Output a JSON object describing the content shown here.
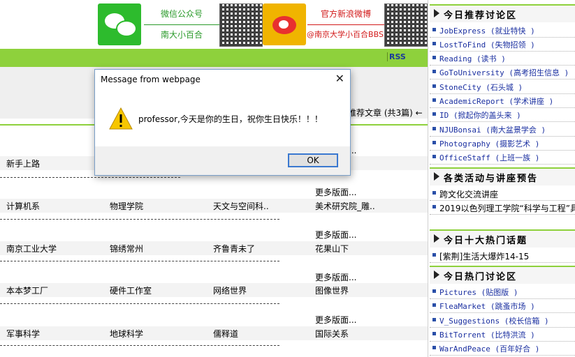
{
  "banner": {
    "wechat_label": "微信公众号",
    "wechat_name": "南大小百合",
    "weibo_label": "官方新浪微博",
    "weibo_handle": "@南京大学小百合BBS"
  },
  "topbar": {
    "rss_label": "RSS"
  },
  "recommend_label": "多推荐文章 (共3篇) ←",
  "boards": {
    "more_label": "更多版面...",
    "rows": [
      [
        "新手上路"
      ],
      [
        "计算机系",
        "物理学院",
        "天文与空间科..",
        "美术研究院_雕.."
      ],
      [
        "南京工业大学",
        "锦绣常州",
        "齐鲁青未了",
        "花果山下"
      ],
      [
        "本本梦工厂",
        "硬件工作室",
        "网络世界",
        "图像世界"
      ],
      [
        "军事科学",
        "地球科学",
        "儒释道",
        "国际关系"
      ]
    ]
  },
  "sidebar": {
    "sections": [
      {
        "title": "今日推荐讨论区",
        "items": [
          "JobExpress (就业特快 )",
          "LostToFind (失物招领 )",
          "Reading (读书 )",
          "GoToUniversity (高考招生信息 )",
          "StoneCity (石头城 )",
          "AcademicReport (学术讲座 )",
          "ID (掀起你的盖头来 )",
          "NJUBonsai (南大盆景学会 )",
          "Photography (摄影艺术 )",
          "OfficeStaff (上班一族 )"
        ]
      },
      {
        "title": "各类活动与讲座预告",
        "items": [
          "跨文化交流讲座",
          "2019以色列理工学院“科学与工程”具"
        ]
      },
      {
        "title": "今日十大热门话题",
        "items": [
          "[紫荆]生活大爆炸14-15"
        ]
      },
      {
        "title": "今日热门讨论区",
        "items": [
          "Pictures (贴图版 )",
          "FleaMarket (跳蚤市场 )",
          "V_Suggestions (校长信箱 )",
          "BitTorrent (比特洪流 )",
          "WarAndPeace (百年好合 )"
        ]
      }
    ]
  },
  "dialog": {
    "title": "Message from webpage",
    "message": "professor,今天是你的生日，祝你生日快乐！！！",
    "ok_label": "OK"
  }
}
